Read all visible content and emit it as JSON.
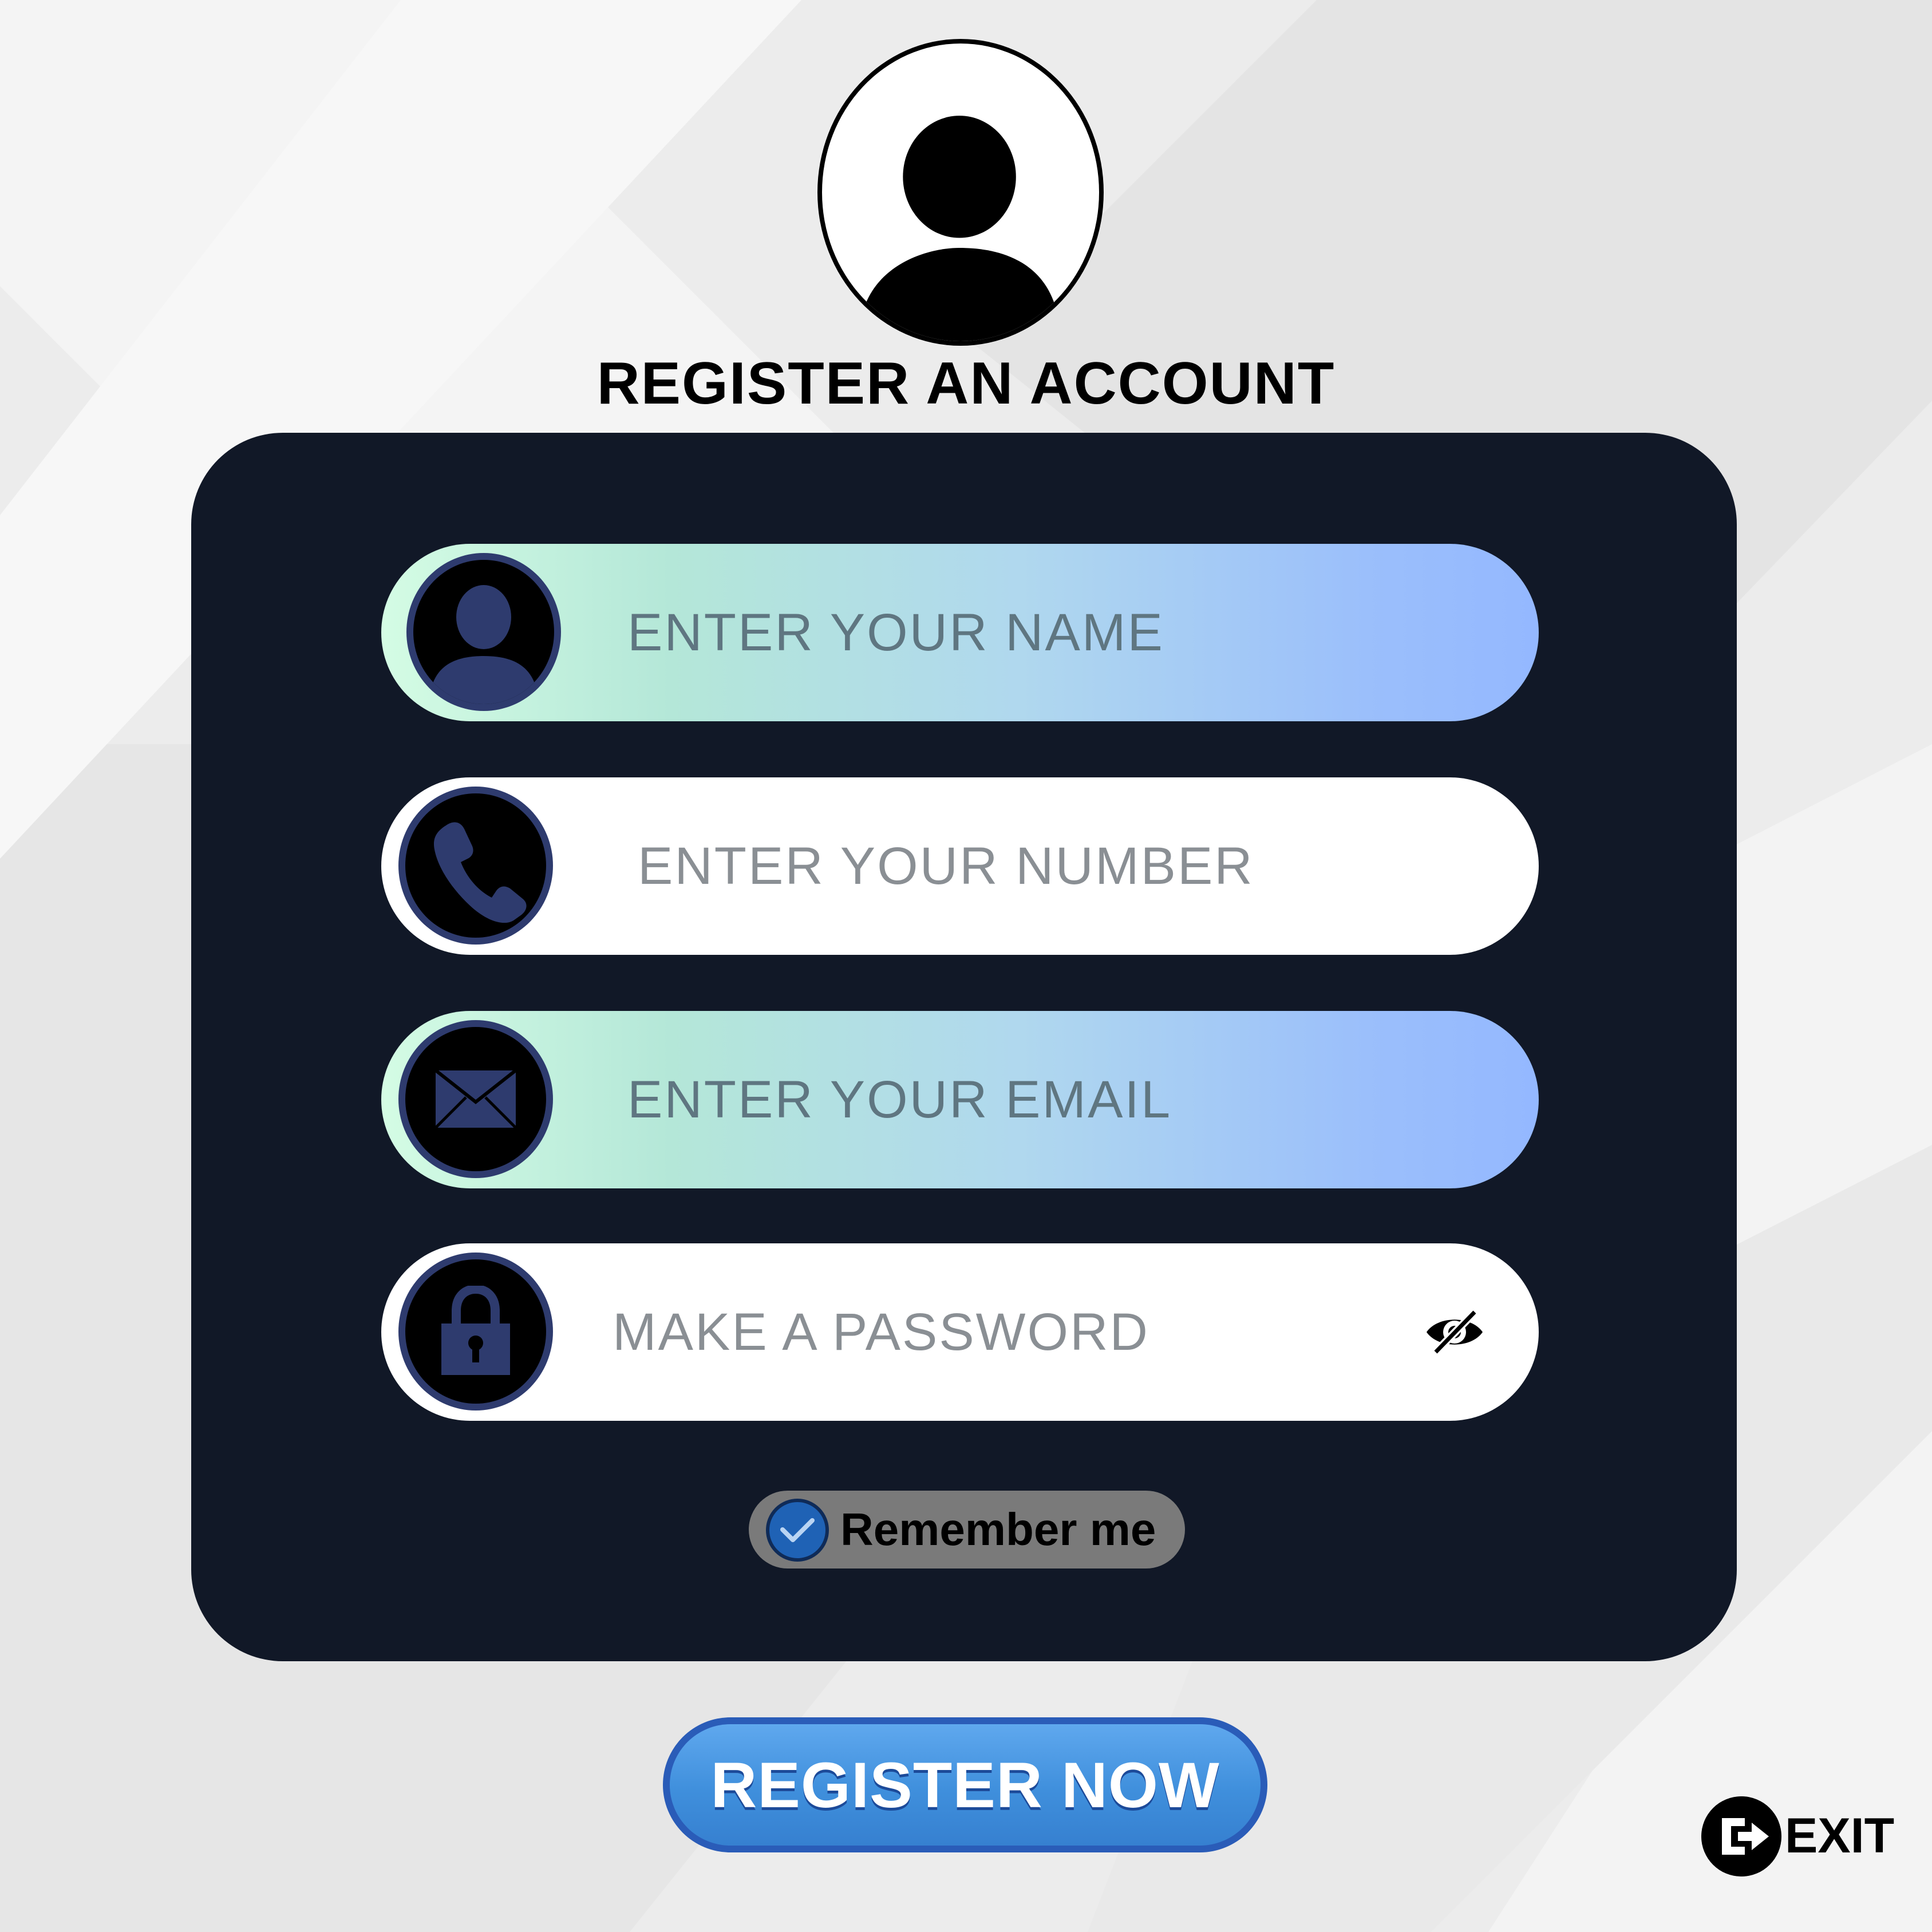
{
  "header": {
    "avatar_icon": "user-avatar-icon",
    "title": "REGISTER AN ACCOUNT"
  },
  "form": {
    "fields": [
      {
        "placeholder": "ENTER YOUR NAME",
        "icon": "user-icon",
        "style": "gradient"
      },
      {
        "placeholder": "ENTER YOUR NUMBER",
        "icon": "phone-icon",
        "style": "white"
      },
      {
        "placeholder": "ENTER YOUR EMAIL",
        "icon": "envelope-icon",
        "style": "gradient"
      },
      {
        "placeholder": "MAKE A PASSWORD",
        "icon": "lock-icon",
        "style": "white",
        "trailing_icon": "eye-slash-icon"
      }
    ],
    "remember": {
      "label": "Remember me",
      "checked": true
    }
  },
  "actions": {
    "register_label": "REGISTER NOW",
    "exit_label": "EXIT"
  },
  "colors": {
    "card": "#111827",
    "icon_accent": "#2e3b6e",
    "button": "#3f8fdc",
    "checkbox": "#1f62b5"
  }
}
